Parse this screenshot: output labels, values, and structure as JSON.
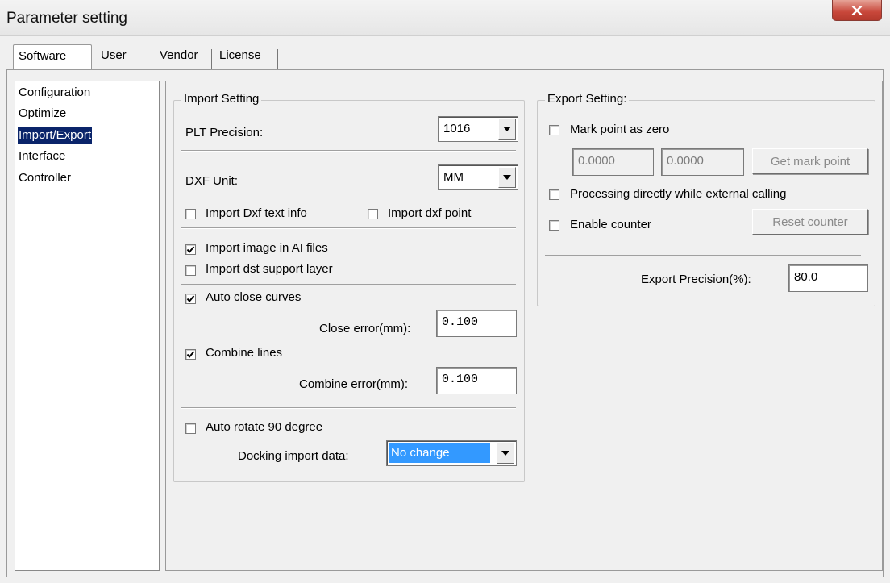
{
  "window": {
    "title": "Parameter setting",
    "close_label": "X"
  },
  "tabs": [
    "Software",
    "User",
    "Vendor",
    "License"
  ],
  "tree": [
    "Configuration",
    "Optimize",
    "Import/Export",
    "Interface",
    "Controller"
  ],
  "import": {
    "title": "Import Setting",
    "plt_label": "PLT Precision:",
    "plt_value": "1016",
    "dxf_label": "DXF Unit:",
    "dxf_value": "MM",
    "dxf_text": "Import Dxf text info",
    "dxf_point": "Import dxf point",
    "ai_image": "Import image in AI files",
    "dst_layer": "Import dst support layer",
    "auto_close": "Auto close curves",
    "close_error_label": "Close error(mm):",
    "close_error_value": "0.100",
    "combine": "Combine lines",
    "combine_error_label": "Combine error(mm):",
    "combine_error_value": "0.100",
    "rotate": "Auto rotate 90 degree",
    "docking_label": "Docking import data:",
    "docking_value": "No change"
  },
  "checks": {
    "dxf_text": false,
    "dxf_point": false,
    "ai_image": true,
    "dst_layer": false,
    "auto_close": true,
    "combine": true,
    "rotate": false,
    "mark_zero": false,
    "direct": false,
    "counter": false
  },
  "export": {
    "title": "Export Setting:",
    "mark_zero": "Mark point as zero",
    "mark_x": "0.0000",
    "mark_y": "0.0000",
    "get_mark": "Get mark point",
    "direct": "Processing directly while external calling",
    "counter": "Enable counter",
    "reset_counter": "Reset counter",
    "precision_label": "Export Precision(%):",
    "precision_value": "80.0"
  },
  "colors": {
    "selection": "#0a246a",
    "highlight": "#3399ff",
    "close": "#c8473a"
  }
}
